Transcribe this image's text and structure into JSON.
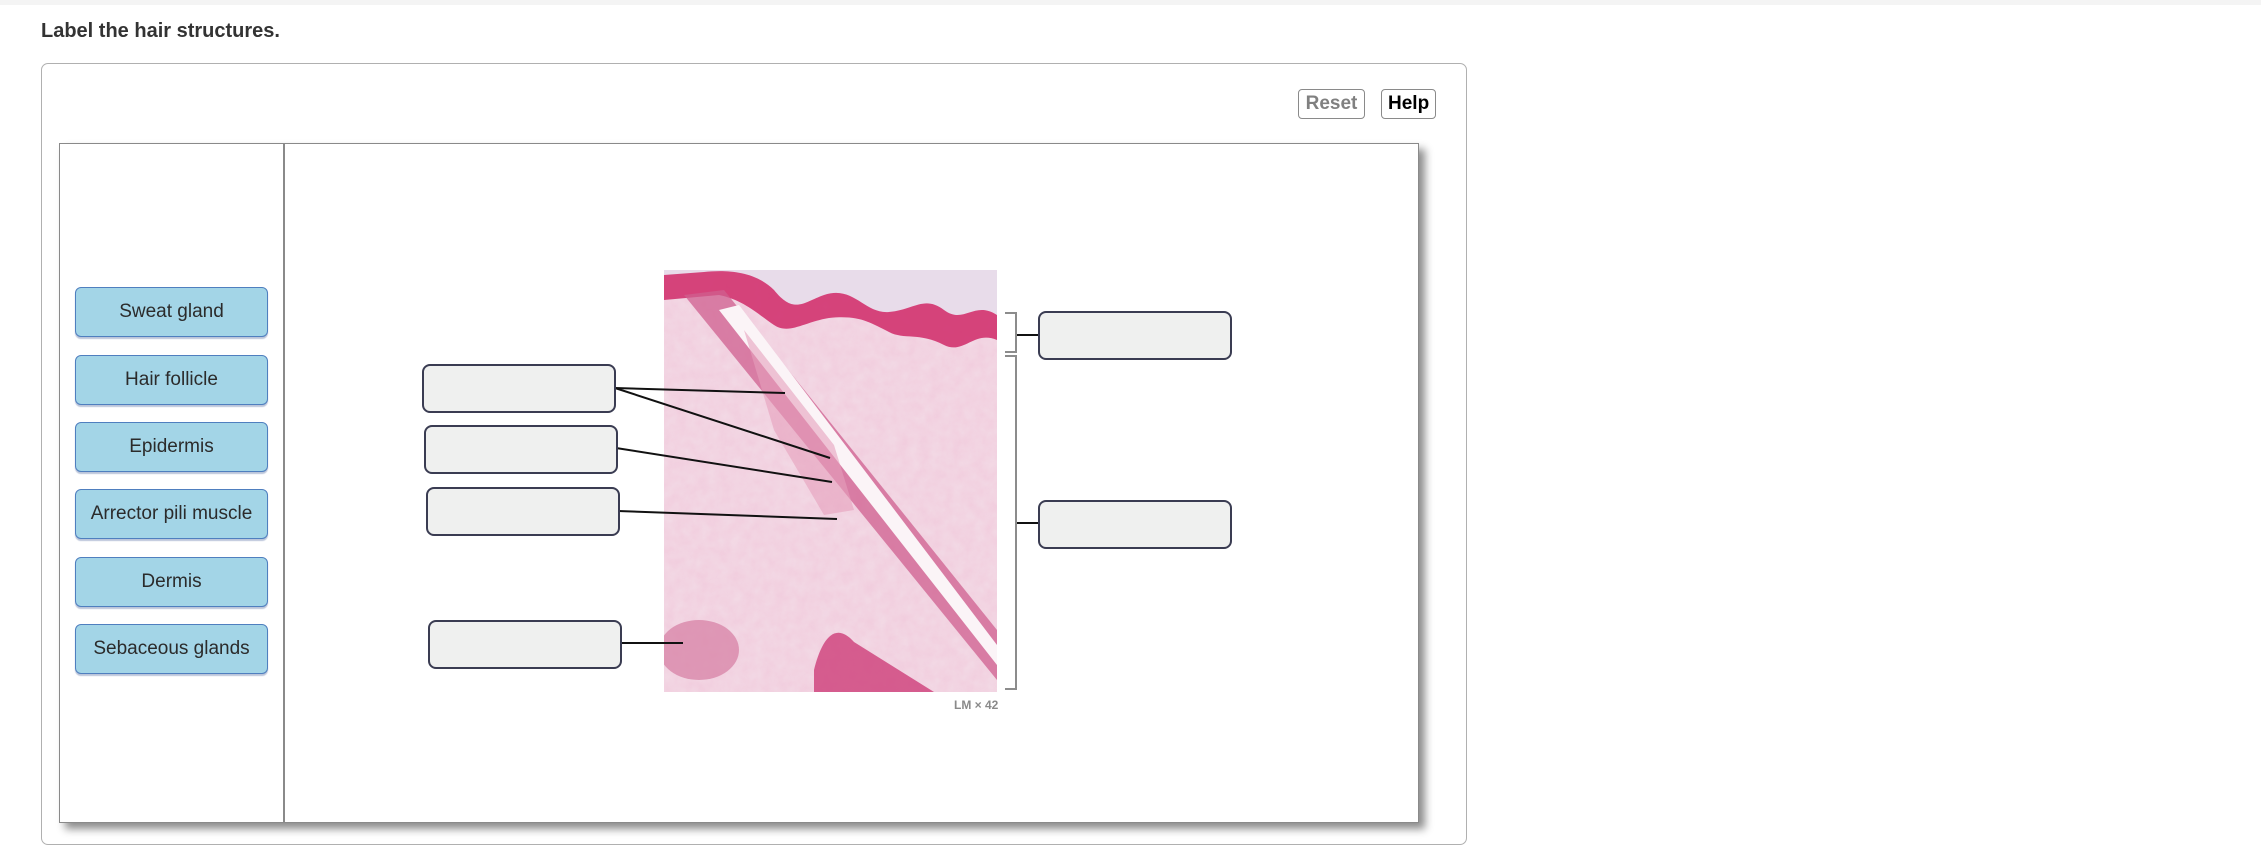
{
  "prompt": "Label the hair structures.",
  "toolbar": {
    "reset_label": "Reset",
    "help_label": "Help"
  },
  "label_bank": [
    {
      "label": "Sweat gland"
    },
    {
      "label": "Hair follicle"
    },
    {
      "label": "Epidermis"
    },
    {
      "label": "Arrector pili muscle"
    },
    {
      "label": "Dermis"
    },
    {
      "label": "Sebaceous glands"
    }
  ],
  "drop_targets": [
    {
      "id": "left-1",
      "value": ""
    },
    {
      "id": "left-2",
      "value": ""
    },
    {
      "id": "left-3",
      "value": ""
    },
    {
      "id": "left-4",
      "value": ""
    },
    {
      "id": "right-1",
      "value": ""
    },
    {
      "id": "right-2",
      "value": ""
    }
  ],
  "image": {
    "caption": "LM × 42",
    "subject": "light micrograph of skin section with hair follicle"
  }
}
